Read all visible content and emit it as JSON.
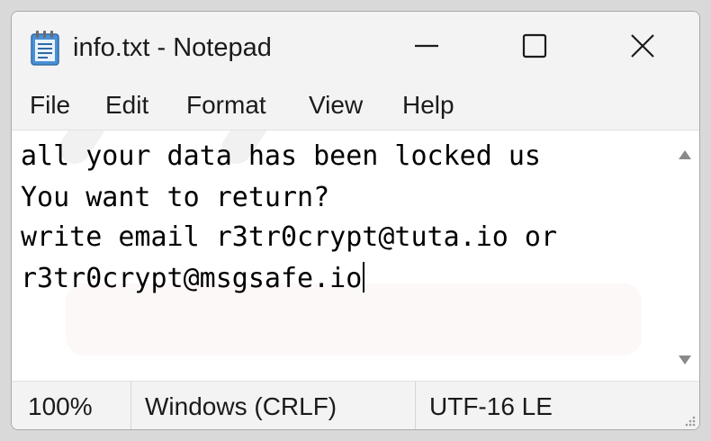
{
  "window": {
    "title": "info.txt - Notepad",
    "controls": {
      "minimize_icon": "minimize-icon",
      "maximize_icon": "maximize-icon",
      "close_icon": "close-icon"
    }
  },
  "menu": {
    "items": [
      {
        "label": "File"
      },
      {
        "label": "Edit"
      },
      {
        "label": "Format"
      },
      {
        "label": "View"
      },
      {
        "label": "Help"
      }
    ]
  },
  "editor": {
    "lines": [
      "all your data has been locked us",
      "You want to return?",
      "write email r3tr0crypt@tuta.io or",
      "r3tr0crypt@msgsafe.io"
    ]
  },
  "status": {
    "zoom": "100%",
    "line_endings": "Windows (CRLF)",
    "encoding": "UTF-16 LE"
  },
  "colors": {
    "chrome": "#f3f3f3",
    "text": "#1b1b1b",
    "editor_bg": "#ffffff",
    "icon_blue": "#3d7fc1"
  }
}
